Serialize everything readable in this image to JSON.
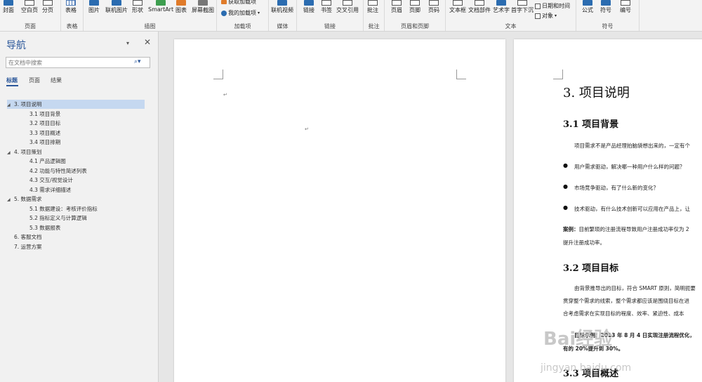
{
  "ribbon": {
    "groups": [
      {
        "label": "页面",
        "buttons": [
          "封面",
          "空白页",
          "分页"
        ]
      },
      {
        "label": "表格",
        "buttons": [
          "表格"
        ]
      },
      {
        "label": "插图",
        "buttons": [
          "图片",
          "联机图片",
          "形状",
          "SmartArt",
          "图表",
          "屏幕截图"
        ]
      },
      {
        "label": "加载项",
        "buttons": [
          "获取加载项",
          "我的加载项"
        ]
      },
      {
        "label": "媒体",
        "buttons": [
          "联机视频"
        ]
      },
      {
        "label": "链接",
        "buttons": [
          "链接",
          "书签",
          "交叉引用"
        ]
      },
      {
        "label": "批注",
        "buttons": [
          "批注"
        ]
      },
      {
        "label": "页眉和页脚",
        "buttons": [
          "页眉",
          "页脚",
          "页码"
        ]
      },
      {
        "label": "文本",
        "buttons": [
          "文本框",
          "文档部件",
          "艺术字",
          "首字下沉",
          "日期和时间",
          "对象"
        ]
      },
      {
        "label": "符号",
        "buttons": [
          "公式",
          "符号",
          "编号"
        ]
      }
    ]
  },
  "nav": {
    "title": "导航",
    "search_placeholder": "在文档中搜索",
    "tabs": [
      "标题",
      "页面",
      "结果"
    ],
    "tree": [
      {
        "label": "3. 项目说明",
        "level": 1,
        "selected": true
      },
      {
        "label": "3.1 项目背景",
        "level": 2
      },
      {
        "label": "3.2 项目目标",
        "level": 2
      },
      {
        "label": "3.3 项目概述",
        "level": 2
      },
      {
        "label": "3.4 项目排期",
        "level": 2
      },
      {
        "label": "4. 项目策划",
        "level": 1
      },
      {
        "label": "4.1 产品逻辑图",
        "level": 2
      },
      {
        "label": "4.2 功能与特性简述列表",
        "level": 2
      },
      {
        "label": "4.3 交互/视觉设计",
        "level": 2
      },
      {
        "label": "4.3 需求详细描述",
        "level": 2
      },
      {
        "label": "5. 数据需求",
        "level": 1
      },
      {
        "label": "5.1 数据建设：考核评价指标",
        "level": 2
      },
      {
        "label": "5.2 指标定义与计算逻辑",
        "level": 2
      },
      {
        "label": "5.3 数据报表",
        "level": 2
      },
      {
        "label": "6. 客服文档",
        "level": 1
      },
      {
        "label": "7. 运营方案",
        "level": 1
      }
    ]
  },
  "doc": {
    "h1": "3.  项目说明",
    "h2_1": "3.1  项目背景",
    "p1": "项目需求不是产品经理拍脑袋想出来的，一定有个",
    "bullets": [
      "用户需求驱动，解决哪一种用户什么样的问题？",
      "市场竞争驱动，有了什么新的变化？",
      "技术驱动，有什么技术创新可以应用在产品上，让"
    ],
    "case_label": "案例：",
    "case_text": "目前繁琐的注册流程导致用户注册成功率仅为 2",
    "case_text2": "提升注册成功率。",
    "h2_2": "3.2  项目目标",
    "p2a": "由背景推导出的目标，符合 SMART 原则，简明扼要",
    "p2b": "贯穿整个需求的线索，整个需求都应该是围绕目标在进",
    "p2c": "合考虑需求在实现目标的程度、效率、紧迫性、成本",
    "p3a": "目标示例：2013 年 8 月 4 日实现注册流程优化，",
    "p3b": "有的 20%提升到 30%。",
    "h2_3": "3.3  项目概述",
    "para_mark": "↵"
  },
  "watermark": {
    "logo": "Bai经验",
    "url": "jingyan.baidu.com"
  }
}
